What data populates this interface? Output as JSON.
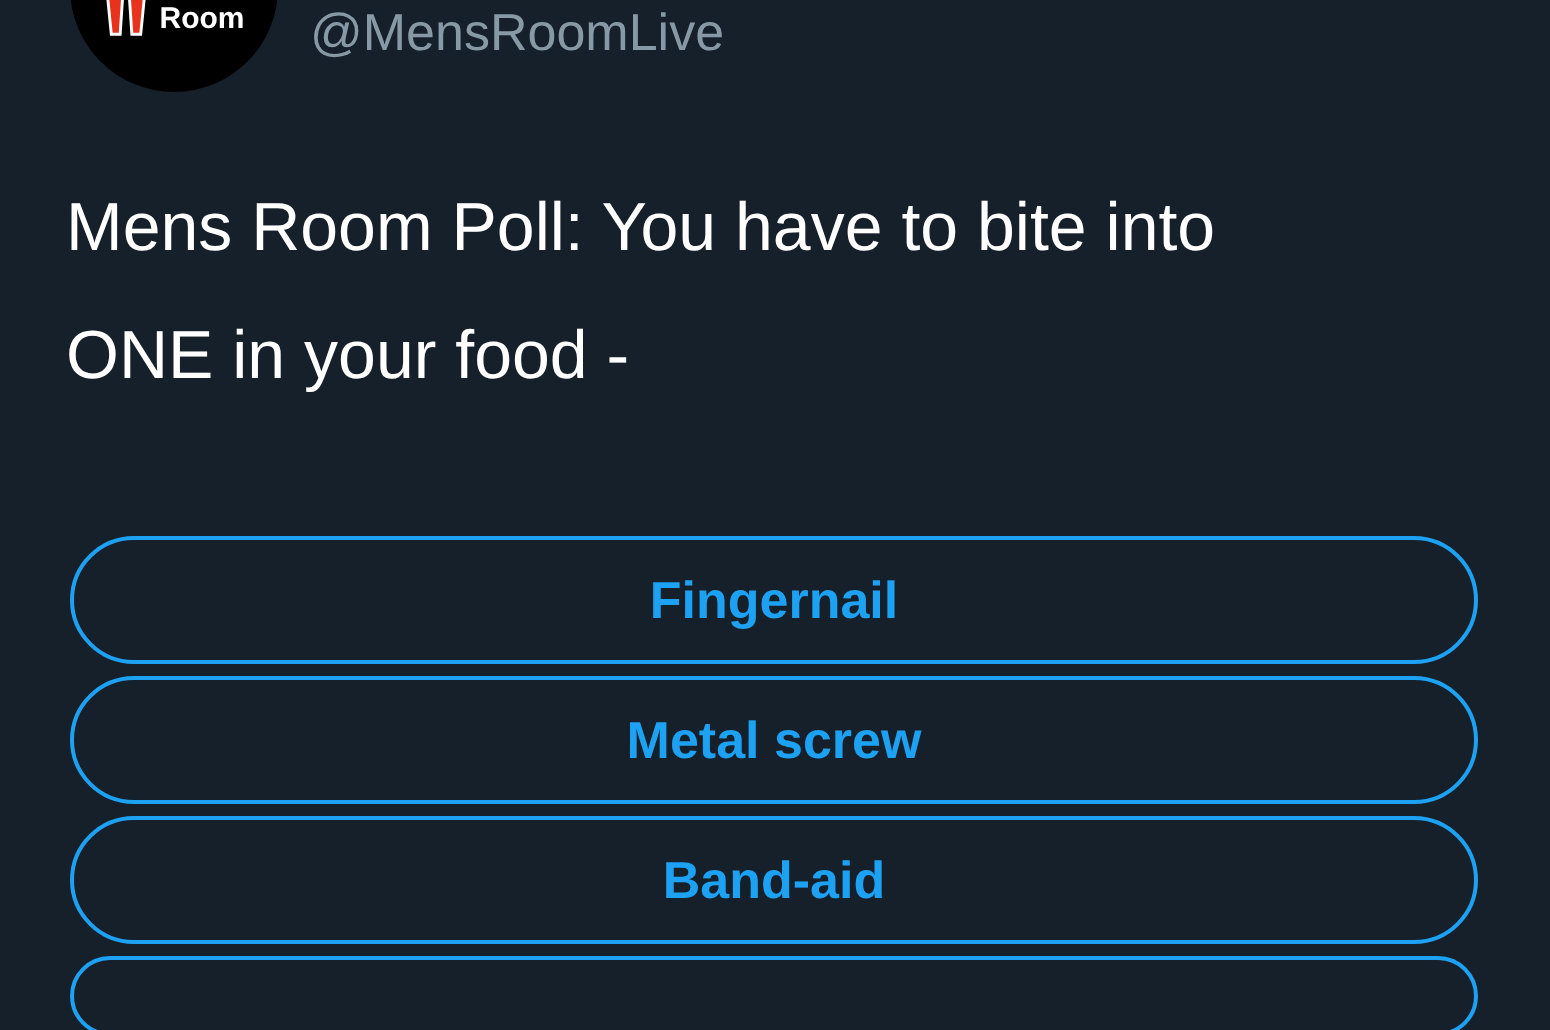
{
  "author": {
    "avatar_logo_text": "Room",
    "handle": "@MensRoomLive"
  },
  "tweet": {
    "text": "Mens Room Poll: You have to bite into ONE in your food -"
  },
  "poll": {
    "options": [
      {
        "kind": "option",
        "label": "Fingernail"
      },
      {
        "kind": "option",
        "label": "Metal screw"
      },
      {
        "kind": "option",
        "label": "Band-aid"
      },
      {
        "kind": "cut"
      }
    ]
  }
}
